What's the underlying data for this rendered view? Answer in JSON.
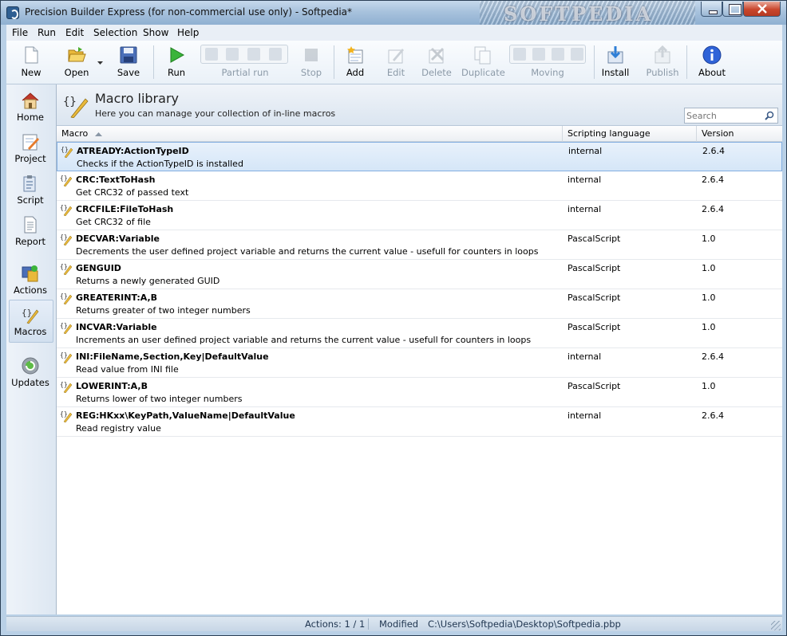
{
  "window": {
    "title": "Precision Builder Express (for non-commercial use only) - Softpedia*",
    "watermark": "SOFTPEDIA"
  },
  "menu": [
    "File",
    "Run",
    "Edit",
    "Selection",
    "Show",
    "Help"
  ],
  "toolbar": {
    "new": "New",
    "open": "Open",
    "save": "Save",
    "run": "Run",
    "partial_run": "Partial run",
    "stop": "Stop",
    "add": "Add",
    "edit": "Edit",
    "delete": "Delete",
    "duplicate": "Duplicate",
    "moving": "Moving",
    "install": "Install",
    "publish": "Publish",
    "about": "About"
  },
  "sidebar": [
    "Home",
    "Project",
    "Script",
    "Report",
    "Actions",
    "Macros",
    "Updates"
  ],
  "header": {
    "title": "Macro library",
    "subtitle": "Here you can manage your collection of in-line macros",
    "search_placeholder": "Search"
  },
  "columns": {
    "macro": "Macro",
    "language": "Scripting language",
    "version": "Version"
  },
  "rows": [
    {
      "name": "ATREADY:ActionTypeID",
      "desc": "Checks if the ActionTypeID is installed",
      "lang": "internal",
      "ver": "2.6.4"
    },
    {
      "name": "CRC:TextToHash",
      "desc": "Get CRC32 of passed text",
      "lang": "internal",
      "ver": "2.6.4"
    },
    {
      "name": "CRCFILE:FileToHash",
      "desc": "Get CRC32 of file",
      "lang": "internal",
      "ver": "2.6.4"
    },
    {
      "name": "DECVAR:Variable",
      "desc": "Decrements the user defined project variable and returns the current value - usefull for counters in loops",
      "lang": "PascalScript",
      "ver": "1.0"
    },
    {
      "name": "GENGUID",
      "desc": "Returns a newly generated GUID",
      "lang": "PascalScript",
      "ver": "1.0"
    },
    {
      "name": "GREATERINT:A,B",
      "desc": "Returns greater of two integer numbers",
      "lang": "PascalScript",
      "ver": "1.0"
    },
    {
      "name": "INCVAR:Variable",
      "desc": "Increments an user defined project variable and returns the current value - usefull for counters in loops",
      "lang": "PascalScript",
      "ver": "1.0"
    },
    {
      "name": "INI:FileName,Section,Key|DefaultValue",
      "desc": "Read value from INI file",
      "lang": "internal",
      "ver": "2.6.4"
    },
    {
      "name": "LOWERINT:A,B",
      "desc": "Returns lower of two integer numbers",
      "lang": "PascalScript",
      "ver": "1.0"
    },
    {
      "name": "REG:HKxx\\KeyPath,ValueName|DefaultValue",
      "desc": "Read registry value",
      "lang": "internal",
      "ver": "2.6.4"
    }
  ],
  "status": {
    "actions": "Actions: 1 / 1",
    "modified": "Modified",
    "path": "C:\\Users\\Softpedia\\Desktop\\Softpedia.pbp"
  }
}
